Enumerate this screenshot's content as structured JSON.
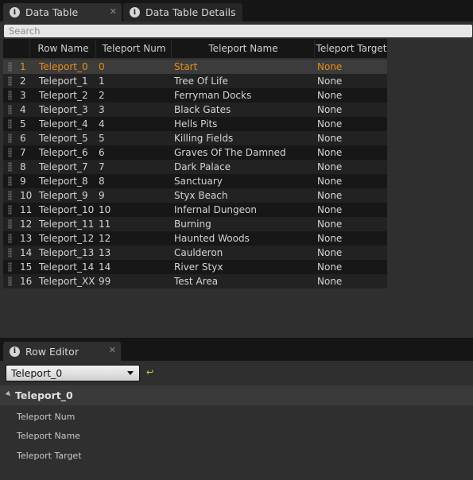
{
  "tabs": [
    {
      "label": "Data Table",
      "icon": "info-icon",
      "close": "✕"
    },
    {
      "label": "Data Table Details",
      "icon": "info-icon"
    }
  ],
  "search": {
    "placeholder": "Search"
  },
  "table": {
    "columns": [
      "Row Name",
      "Teleport Num",
      "Teleport Name",
      "Teleport Target"
    ],
    "rows": [
      {
        "idx": "1",
        "name": "Teleport_0",
        "num": "0",
        "tname": "Start",
        "target": "None"
      },
      {
        "idx": "2",
        "name": "Teleport_1",
        "num": "1",
        "tname": "Tree Of Life",
        "target": "None"
      },
      {
        "idx": "3",
        "name": "Teleport_2",
        "num": "2",
        "tname": "Ferryman Docks",
        "target": "None"
      },
      {
        "idx": "4",
        "name": "Teleport_3",
        "num": "3",
        "tname": "Black Gates",
        "target": "None"
      },
      {
        "idx": "5",
        "name": "Teleport_4",
        "num": "4",
        "tname": "Hells Pits",
        "target": "None"
      },
      {
        "idx": "6",
        "name": "Teleport_5",
        "num": "5",
        "tname": "Killing Fields",
        "target": "None"
      },
      {
        "idx": "7",
        "name": "Teleport_6",
        "num": "6",
        "tname": "Graves Of The Damned",
        "target": "None"
      },
      {
        "idx": "8",
        "name": "Teleport_7",
        "num": "7",
        "tname": "Dark Palace",
        "target": "None"
      },
      {
        "idx": "9",
        "name": "Teleport_8",
        "num": "8",
        "tname": "Sanctuary",
        "target": "None"
      },
      {
        "idx": "10",
        "name": "Teleport_9",
        "num": "9",
        "tname": "Styx Beach",
        "target": "None"
      },
      {
        "idx": "11",
        "name": "Teleport_10",
        "num": "10",
        "tname": "Infernal Dungeon",
        "target": "None"
      },
      {
        "idx": "12",
        "name": "Teleport_11",
        "num": "11",
        "tname": "Burning",
        "target": "None"
      },
      {
        "idx": "13",
        "name": "Teleport_12",
        "num": "12",
        "tname": "Haunted Woods",
        "target": "None"
      },
      {
        "idx": "14",
        "name": "Teleport_13",
        "num": "13",
        "tname": "Caulderon",
        "target": "None"
      },
      {
        "idx": "15",
        "name": "Teleport_14",
        "num": "14",
        "tname": "River Styx",
        "target": "None"
      },
      {
        "idx": "16",
        "name": "Teleport_XX",
        "num": "99",
        "tname": "Test Area",
        "target": "None"
      }
    ],
    "selected_row": 0
  },
  "row_editor": {
    "tab_label": "Row Editor",
    "tab_close": "✕",
    "dropdown_value": "Teleport_0",
    "reset_icon": "↩",
    "section_title": "Teleport_0",
    "properties": [
      "Teleport Num",
      "Teleport Name",
      "Teleport Target"
    ]
  },
  "colors": {
    "selected_text": "#e98c1a",
    "accent_reset": "#e0d24a"
  }
}
